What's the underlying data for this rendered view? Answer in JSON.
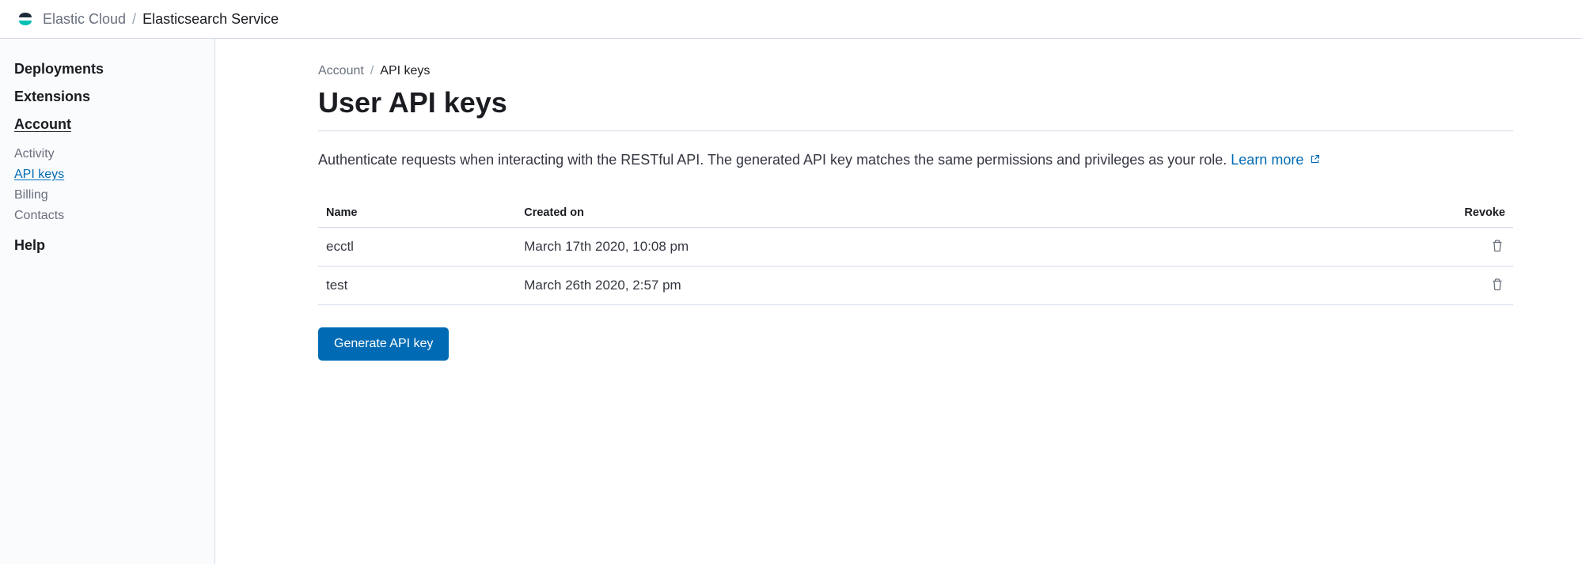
{
  "header": {
    "product": "Elastic Cloud",
    "service": "Elasticsearch Service"
  },
  "sidebar": {
    "deployments": "Deployments",
    "extensions": "Extensions",
    "account": "Account",
    "account_items": [
      {
        "label": "Activity"
      },
      {
        "label": "API keys"
      },
      {
        "label": "Billing"
      },
      {
        "label": "Contacts"
      }
    ],
    "help": "Help"
  },
  "breadcrumb": {
    "parent": "Account",
    "current": "API keys"
  },
  "page": {
    "title": "User API keys",
    "description": "Authenticate requests when interacting with the RESTful API. The generated API key matches the same permissions and privileges as your role. ",
    "learn_more": "Learn more"
  },
  "table": {
    "headers": {
      "name": "Name",
      "created": "Created on",
      "revoke": "Revoke"
    },
    "rows": [
      {
        "name": "ecctl",
        "created": "March 17th 2020, 10:08 pm"
      },
      {
        "name": "test",
        "created": "March 26th 2020, 2:57 pm"
      }
    ]
  },
  "buttons": {
    "generate": "Generate API key"
  }
}
